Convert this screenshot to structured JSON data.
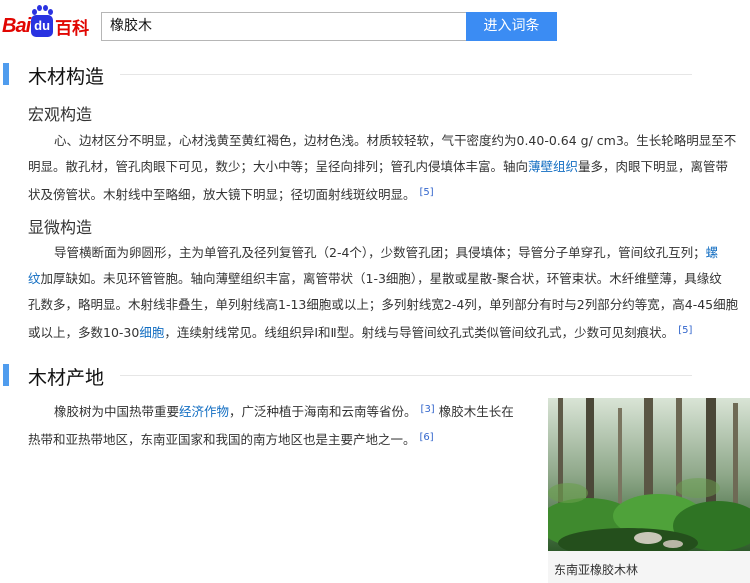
{
  "header": {
    "logo": {
      "bai": "Bai",
      "du": "du",
      "baike": "百科"
    },
    "search_value": "橡胶木",
    "search_button": "进入词条"
  },
  "section1": {
    "title": "木材构造",
    "sub1": {
      "title": "宏观构造",
      "lines": [
        "心、边材区分不明显，心材浅黄至黄红褐色，边材色浅。材质较轻软，气干密度约为0.40-0.64 g/ cm3。生长轮略明显至不",
        "明显。散孔材，管孔肉眼下可见，数少；大小中等；呈径向排列；管孔内侵填体丰富。轴向",
        "量多，肉眼下明显，离管带",
        "状及傍管状。木射线中至略细，放大镜下明显；径切面射线斑纹明显。"
      ],
      "link": "薄壁组织",
      "ref": "[5]"
    },
    "sub2": {
      "title": "显微构造",
      "l1": "导管横断面为卵圆形，主为单管孔及径列复管孔（2-4个），少数管孔团；具侵填体；导管分子单穿孔，管间纹孔互列；",
      "l1_link": "螺",
      "l2_link": "纹",
      "l2": "加厚缺如。未见环管管胞。轴向薄壁组织丰富，离管带状（1-3细胞），星散或星散-聚合状，环管束状。木纤维壁薄，具缘纹",
      "l3": "孔数多，略明显。木射线非叠生，单列射线高1-13细胞或以上；多列射线宽2-4列，单列部分有时与2列部分约等宽，高4-45细胞",
      "l4a": "或以上，多数10-30",
      "l4_link": "细胞",
      "l4b": "，连续射线常见。线组织异Ⅰ和Ⅱ型。射线与导管间纹孔式类似管间纹孔式，少数可见刻痕状。",
      "ref": "[5]"
    }
  },
  "section2": {
    "title": "木材产地",
    "l1a": "橡胶树为中国热带重要",
    "l1_link": "经济作物",
    "l1b": "，广泛种植于海南和云南等省份。",
    "ref1": "[3]",
    "l1c": "橡胶木生长在",
    "l2": "热带和亚热带地区，东南亚国家和我国的南方地区也是主要产地之一。",
    "ref2": "[6]",
    "caption": "东南亚橡胶木林"
  }
}
